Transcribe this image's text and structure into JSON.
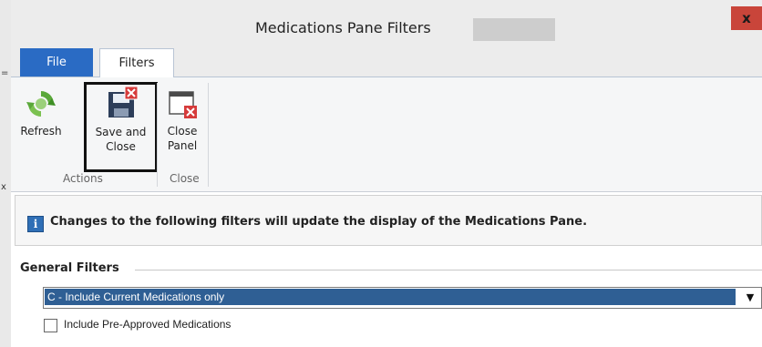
{
  "window": {
    "title": "Medications Pane Filters",
    "close_glyph": "x"
  },
  "background": {
    "marks": [
      "=",
      "x"
    ]
  },
  "tabs": [
    {
      "label": "File",
      "active": false,
      "color": "#2a6bc4"
    },
    {
      "label": "Filters",
      "active": true
    }
  ],
  "ribbon": {
    "buttons": [
      {
        "label_line1": "Refresh",
        "label_line2": "",
        "icon": "refresh-icon"
      },
      {
        "label_line1": "Save and",
        "label_line2": "Close",
        "icon": "save-and-close-icon"
      },
      {
        "label_line1": "Close",
        "label_line2": "Panel",
        "icon": "close-panel-icon"
      }
    ],
    "groups": [
      {
        "label": "Actions"
      },
      {
        "label": "Close"
      }
    ]
  },
  "info": {
    "icon": "info-icon",
    "text": "Changes to the following filters will update the display of the Medications Pane."
  },
  "general_filters": {
    "title": "General Filters",
    "medication_select": {
      "value": "C - Include Current Medications only",
      "highlight_color": "#2f5f94"
    },
    "checkbox": {
      "label": "Include Pre-Approved Medications",
      "checked": false
    }
  }
}
